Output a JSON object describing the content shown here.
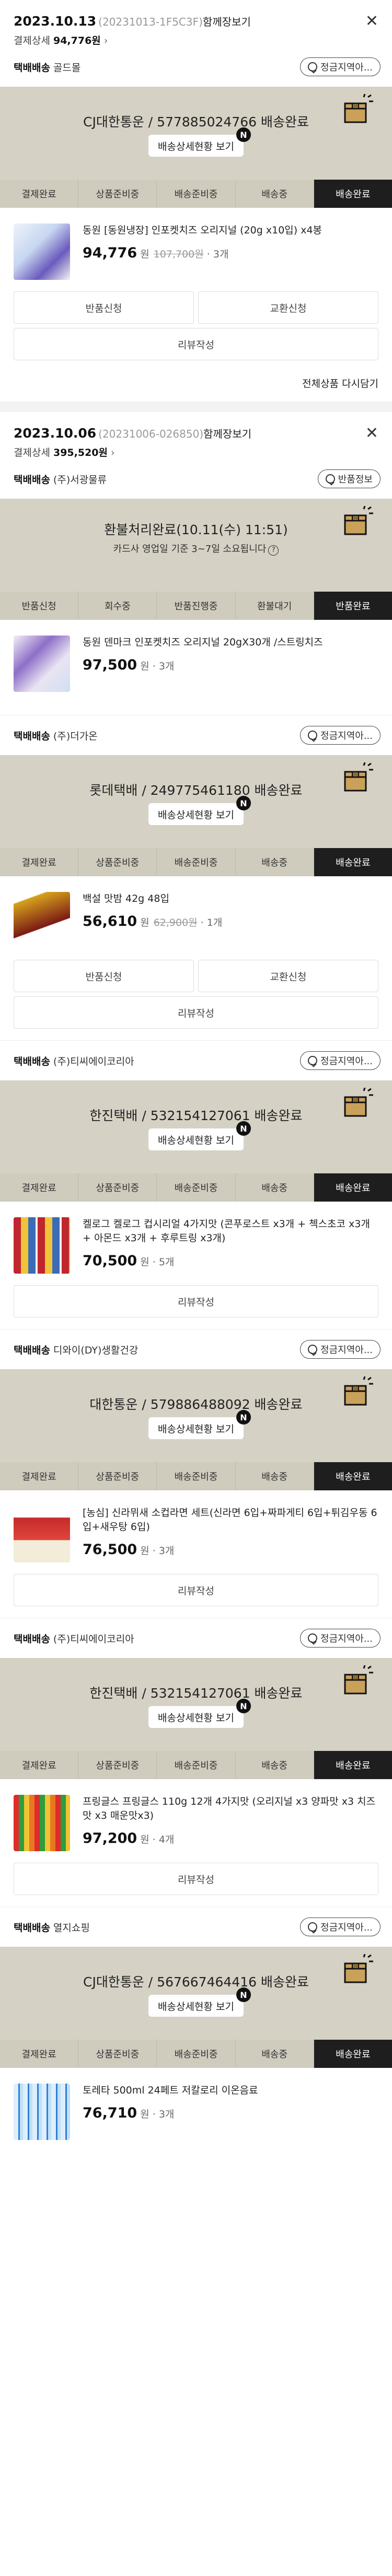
{
  "colors": {
    "band": "#d5d1c4",
    "active_step": "#1e1e1e"
  },
  "orders": [
    {
      "date": "2023.10.13",
      "order_no": "(20231013-1F5C3F)",
      "link": "함께장보기",
      "pay_label": "결제상세",
      "pay_amount": "94,776원",
      "rebuy": "전체상품 다시담기",
      "packages": [
        {
          "seller_label": "택배배송",
          "seller": "골드몰",
          "pill": "정금지역아...",
          "band_title": "CJ대한통운 / 577885024766 배송완료",
          "band_btn": "배송상세현황 보기",
          "steps": [
            "결제완료",
            "상품준비중",
            "배송준비중",
            "배송중",
            "배송완료"
          ],
          "active": 4,
          "product": {
            "name": "동원 [동원냉장] 인포켓치즈 오리지널 (20g x10입) x4봉",
            "price": "94,776",
            "price_unit": "원",
            "orig": "107,700원",
            "qty": "3개",
            "qty_sep": "·"
          },
          "buttons": [
            [
              "반품신청",
              "교환신청"
            ],
            [
              "리뷰작성"
            ]
          ]
        }
      ]
    },
    {
      "date": "2023.10.06",
      "order_no": "(20231006-026850)",
      "link": "함께장보기",
      "pay_label": "결제상세",
      "pay_amount": "395,520원",
      "packages": [
        {
          "seller_label": "택배배송",
          "seller": "(주)서광물류",
          "pill": "반품정보",
          "band_title": "환불처리완료(10.11(수) 11:51)",
          "band_note": "카드사 영업일 기준 3~7일 소요됩니다",
          "refund": true,
          "steps": [
            "반품신청",
            "회수중",
            "반품진행중",
            "환불대기",
            "반품완료"
          ],
          "active": 4,
          "product": {
            "name": "동원 덴마크 인포켓치즈 오리지널 20gX30개 /스트링치즈",
            "price": "97,500",
            "price_unit": "원",
            "orig": "",
            "qty": "3개",
            "qty_sep": "·"
          },
          "buttons": []
        },
        {
          "seller_label": "택배배송",
          "seller": "(주)더가온",
          "pill": "정금지역아...",
          "band_title": "롯데택배 / 249775461180 배송완료",
          "band_btn": "배송상세현황 보기",
          "steps": [
            "결제완료",
            "상품준비중",
            "배송준비중",
            "배송중",
            "배송완료"
          ],
          "active": 4,
          "product": {
            "name": "백설 맛밤 42g 48입",
            "price": "56,610",
            "price_unit": "원",
            "orig": "62,900원",
            "qty": "1개",
            "qty_sep": "·"
          },
          "buttons": [
            [
              "반품신청",
              "교환신청"
            ],
            [
              "리뷰작성"
            ]
          ]
        },
        {
          "seller_label": "택배배송",
          "seller": "(주)티씨에이코리아",
          "pill": "정금지역아...",
          "band_title": "한진택배 / 532154127061 배송완료",
          "band_btn": "배송상세현황 보기",
          "steps": [
            "결제완료",
            "상품준비중",
            "배송준비중",
            "배송중",
            "배송완료"
          ],
          "active": 4,
          "product": {
            "name": "켈로그 켈로그 컵시리얼 4가지맛 (콘푸로스트 x3개 + 첵스초코 x3개 + 아몬드 x3개 + 후루트링 x3개)",
            "price": "70,500",
            "price_unit": "원",
            "orig": "",
            "qty": "5개",
            "qty_sep": "·"
          },
          "buttons": [
            [
              "리뷰작성"
            ]
          ]
        },
        {
          "seller_label": "택배배송",
          "seller": "디와이(DY)생활건강",
          "pill": "정금지역아...",
          "band_title": "대한통운 / 579886488092 배송완료",
          "band_btn": "배송상세현황 보기",
          "steps": [
            "결제완료",
            "상품준비중",
            "배송준비중",
            "배송중",
            "배송완료"
          ],
          "active": 4,
          "product": {
            "name": "[농심] 신라뮈새 소컵라면 세트(신라면 6입+짜파게티 6입+튀김우동 6입+새우탕 6입)",
            "price": "76,500",
            "price_unit": "원",
            "orig": "",
            "qty": "3개",
            "qty_sep": "·"
          },
          "buttons": [
            [
              "리뷰작성"
            ]
          ]
        },
        {
          "seller_label": "택배배송",
          "seller": "(주)티씨에이코리아",
          "pill": "정금지역아...",
          "band_title": "한진택배 / 532154127061 배송완료",
          "band_btn": "배송상세현황 보기",
          "steps": [
            "결제완료",
            "상품준비중",
            "배송준비중",
            "배송중",
            "배송완료"
          ],
          "active": 4,
          "product": {
            "name": "프링글스 프링글스 110g 12개 4가지맛 (오리지널 x3 양파맛 x3 치즈맛 x3 매운맛x3)",
            "price": "97,200",
            "price_unit": "원",
            "orig": "",
            "qty": "4개",
            "qty_sep": "·"
          },
          "buttons": [
            [
              "리뷰작성"
            ]
          ]
        },
        {
          "seller_label": "택배배송",
          "seller": "열지쇼핑",
          "pill": "정금지역아...",
          "band_title": "CJ대한통운 / 567667464416 배송완료",
          "band_btn": "배송상세현황 보기",
          "steps": [
            "결제완료",
            "상품준비중",
            "배송준비중",
            "배송중",
            "배송완료"
          ],
          "active": 4,
          "product": {
            "name": "토레타 500ml 24페트 저칼로리 이온음료",
            "price": "76,710",
            "price_unit": "원",
            "orig": "",
            "qty": "3개",
            "qty_sep": "·"
          },
          "buttons": []
        }
      ]
    }
  ],
  "badge": "N",
  "icons": {
    "close": "close-icon",
    "info": "info-icon",
    "box": "delivery-box-icon"
  }
}
